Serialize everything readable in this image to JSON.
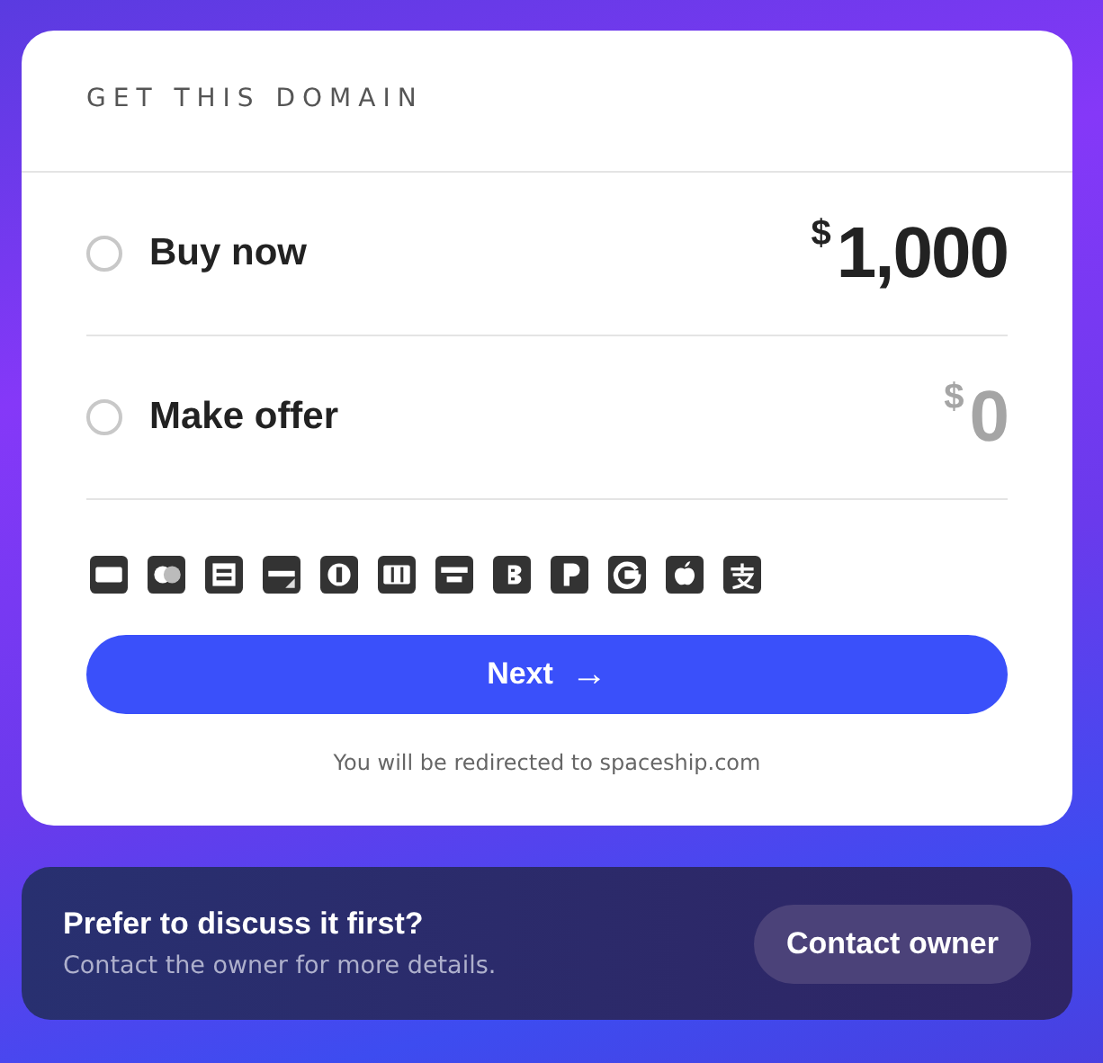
{
  "card": {
    "title": "GET THIS DOMAIN",
    "options": [
      {
        "label": "Buy now",
        "currency": "$",
        "amount": "1,000",
        "kind": "price",
        "selected": false
      },
      {
        "label": "Make offer",
        "currency": "$",
        "amount": "0",
        "kind": "offer",
        "selected": false
      }
    ],
    "next_button": {
      "label": "Next",
      "icon": "→"
    },
    "note": "You will be redirected to spaceship.com"
  },
  "contact": {
    "title": "Prefer to discuss it first?",
    "subtitle": "Contact the owner for more details.",
    "button": "Contact owner"
  }
}
